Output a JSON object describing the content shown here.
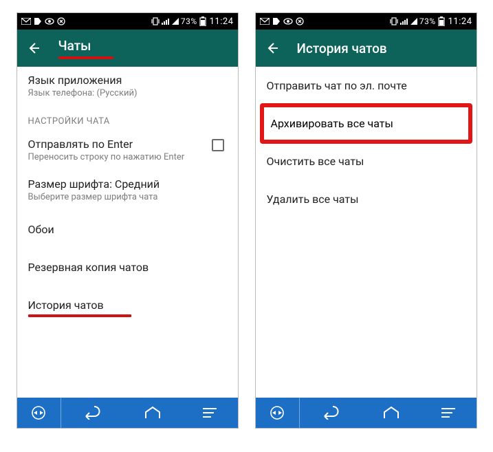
{
  "status": {
    "battery": "73%",
    "time": "11:24"
  },
  "left_screen": {
    "title": "Чаты",
    "lang_title": "Язык приложения",
    "lang_sub": "Язык телефона: (Русский)",
    "category": "НАСТРОЙКИ ЧАТА",
    "enter_title": "Отправлять по Enter",
    "enter_sub": "Переносить строку по нажатию Enter",
    "font_title": "Размер шрифта: Средний",
    "font_sub": "Выберите размер шрифта чата",
    "wallpaper": "Обои",
    "backup": "Резервная копия чатов",
    "history": "История чатов"
  },
  "right_screen": {
    "title": "История чатов",
    "send_email": "Отправить чат по эл. почте",
    "archive_all": "Архивировать все чаты",
    "clear_all": "Очистить все чаты",
    "delete_all": "Удалить все чаты"
  }
}
